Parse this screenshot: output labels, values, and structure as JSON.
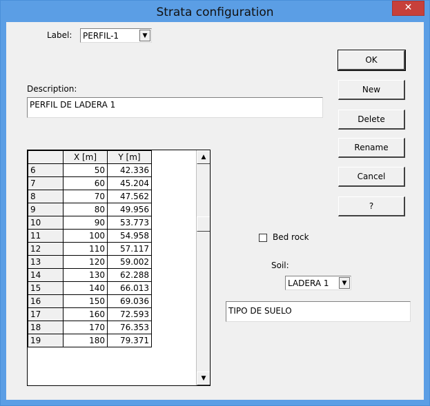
{
  "window": {
    "title": "Strata configuration",
    "close_glyph": "✕"
  },
  "label_field": {
    "label": "Label:",
    "value": "PERFIL-1"
  },
  "description": {
    "label": "Description:",
    "value": "PERFIL DE LADERA 1"
  },
  "buttons": {
    "ok": "OK",
    "new": "New",
    "delete": "Delete",
    "rename": "Rename",
    "cancel": "Cancel",
    "help": "?"
  },
  "table": {
    "headers": [
      "",
      "X [m]",
      "Y [m]"
    ],
    "rows": [
      [
        "6",
        "50",
        "42.336"
      ],
      [
        "7",
        "60",
        "45.204"
      ],
      [
        "8",
        "70",
        "47.562"
      ],
      [
        "9",
        "80",
        "49.956"
      ],
      [
        "10",
        "90",
        "53.773"
      ],
      [
        "11",
        "100",
        "54.958"
      ],
      [
        "12",
        "110",
        "57.117"
      ],
      [
        "13",
        "120",
        "59.002"
      ],
      [
        "14",
        "130",
        "62.288"
      ],
      [
        "15",
        "140",
        "66.013"
      ],
      [
        "16",
        "150",
        "69.036"
      ],
      [
        "17",
        "160",
        "72.593"
      ],
      [
        "18",
        "170",
        "76.353"
      ],
      [
        "19",
        "180",
        "79.371"
      ]
    ]
  },
  "bedrock": {
    "label": "Bed rock",
    "checked": false
  },
  "soil": {
    "label": "Soil:",
    "value": "LADERA 1",
    "description": "TIPO DE SUELO"
  },
  "colors": {
    "titlebar": "#5b9ee5",
    "close": "#c7403a",
    "dialog_bg": "#f0f0f0"
  }
}
